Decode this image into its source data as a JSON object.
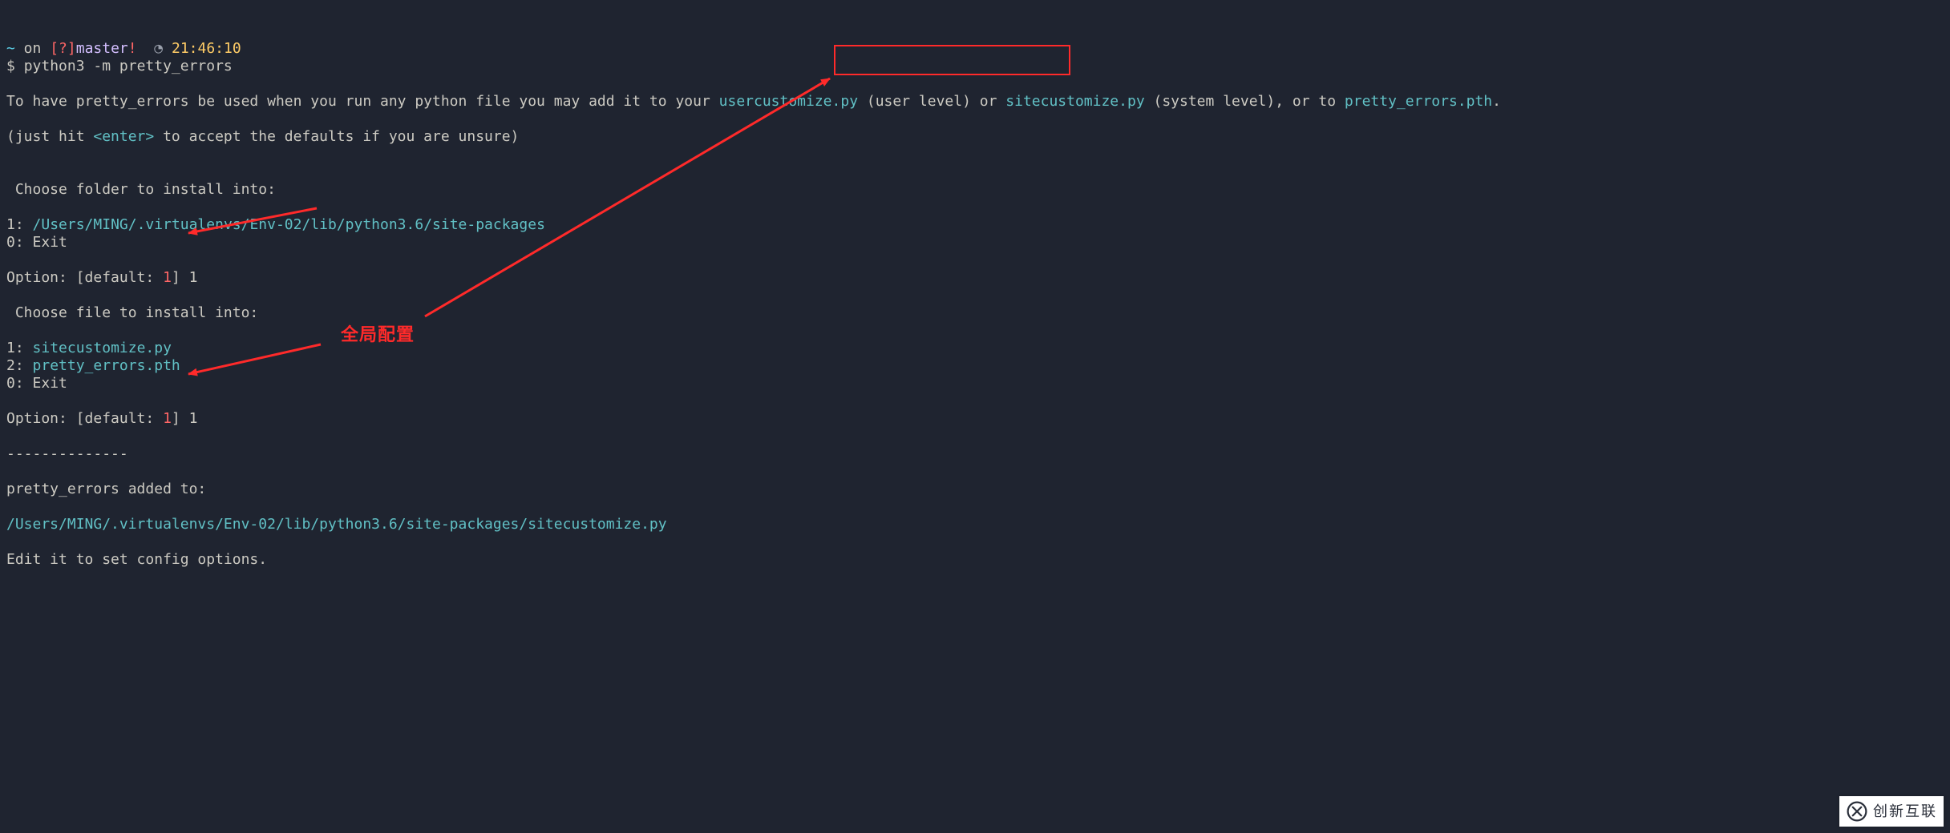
{
  "prompt": {
    "tilde": "~",
    "on": " on ",
    "lbracket": "[",
    "question": "?",
    "rbracket": "]",
    "branch": "master",
    "bang": "!",
    "sep": "  ",
    "clock_glyph": "◔",
    "space": " ",
    "time": "21:46:10"
  },
  "cmd": {
    "dollar": "$ ",
    "text": "python3 -m pretty_errors"
  },
  "msg": {
    "l1a": "To have pretty_errors be used when you run any python file you may add it to your ",
    "usercustomize": "usercustomize.py",
    "l1b": " (user level) or ",
    "sitecustomize": "sitecustomize.py",
    "l1c": " (system level), or to ",
    "pth": "pretty_errors.pth",
    "l1d": ".",
    "l2a": "(just hit ",
    "enter": "<enter>",
    "l2b": " to accept the defaults if you are unsure)"
  },
  "sec1": {
    "title": " Choose folder to install into:",
    "opt1_idx": "1",
    "colon": ": ",
    "opt1_path": "/Users/MING/.virtualenvs/Env-02/lib/python3.6/site-packages",
    "opt0_idx": "0",
    "opt0_label": "Exit",
    "option_label": "Option: [default: ",
    "option_default": "1",
    "option_close": "] ",
    "option_input": "1"
  },
  "sec2": {
    "title": " Choose file to install into:",
    "opt1_idx": "1",
    "opt1_file": "sitecustomize.py",
    "opt2_idx": "2",
    "opt2_file": "pretty_errors.pth",
    "opt0_idx": "0",
    "opt0_label": "Exit",
    "option_label": "Option: [default: ",
    "option_default": "1",
    "option_close": "] ",
    "option_input": "1"
  },
  "tail": {
    "dashes": "--------------",
    "added": "pretty_errors added to:",
    "path": "/Users/MING/.virtualenvs/Env-02/lib/python3.6/site-packages/sitecustomize.py",
    "edit": "Edit it to set config options."
  },
  "anno": {
    "label": "全局配置"
  },
  "watermark": {
    "text": "创新互联"
  }
}
